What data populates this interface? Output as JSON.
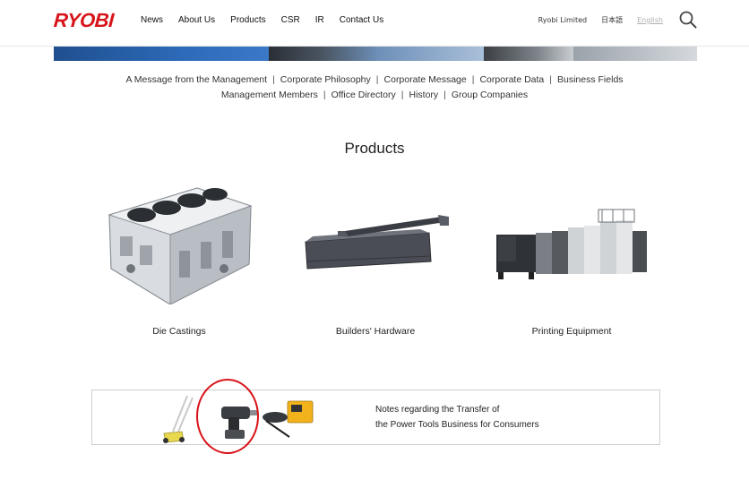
{
  "brand": {
    "logo_text": "RYOBI",
    "accent_color": "#d7141a"
  },
  "nav": {
    "items": [
      "News",
      "About Us",
      "Products",
      "CSR",
      "IR",
      "Contact Us"
    ]
  },
  "header_right": {
    "site_name": "Ryobi Limited",
    "japanese": "日本語",
    "english": "English",
    "search_icon": "search-icon"
  },
  "subnav": {
    "row1": [
      "A Message from the Management",
      "Corporate Philosophy",
      "Corporate Message",
      "Corporate Data",
      "Business Fields"
    ],
    "row2": [
      "Management Members",
      "Office Directory",
      "History",
      "Group Companies"
    ]
  },
  "main": {
    "title": "Products",
    "products": [
      {
        "label": "Die Castings",
        "icon": "engine-block-icon"
      },
      {
        "label": "Builders' Hardware",
        "icon": "door-closer-icon"
      },
      {
        "label": "Printing Equipment",
        "icon": "printing-press-icon"
      }
    ]
  },
  "notes": {
    "line1": "Notes regarding the Transfer of",
    "line2": "the Power Tools Business for Consumers"
  }
}
